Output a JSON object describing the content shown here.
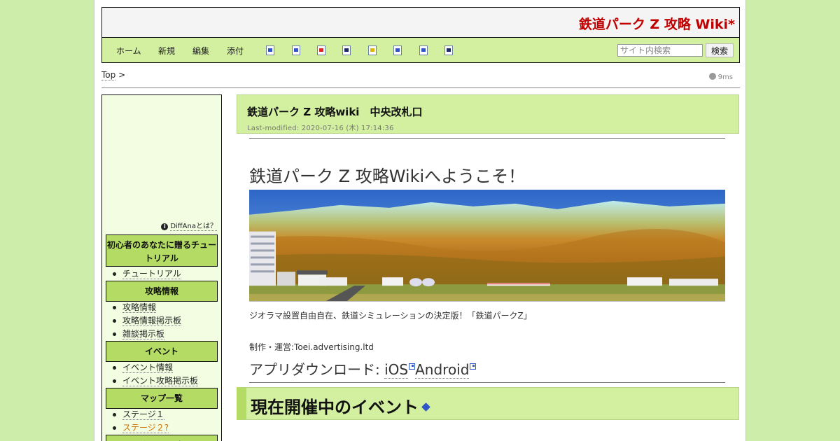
{
  "header": {
    "site_title": "鉄道パーク Z 攻略 Wiki*"
  },
  "nav": {
    "links": [
      "ホーム",
      "新規",
      "編集",
      "添付"
    ],
    "search_placeholder": "サイト内検索",
    "search_button": "検索"
  },
  "breadcrumb": {
    "top": "Top",
    "sep": ">"
  },
  "timer": "9ms",
  "sidebar": {
    "ad_link": "DiffAnaとは？",
    "sections": [
      {
        "title": "初心者のあなたに贈るチュートリアル",
        "items": [
          "チュートリアル"
        ]
      },
      {
        "title": "攻略情報",
        "items": [
          "攻略情報",
          "攻略情報掲示板",
          "雑談掲示板"
        ]
      },
      {
        "title": "イベント",
        "items": [
          "イベント情報",
          "イベント攻略掲示板"
        ]
      },
      {
        "title": "マップ一覧",
        "items": [
          "ステージ１",
          "ステージ２?"
        ]
      },
      {
        "title": "タワー一覧",
        "items": []
      }
    ]
  },
  "content": {
    "title": "鉄道パーク Z 攻略wiki　中央改札口",
    "last_modified": "Last-modified: 2020-07-16 (木) 17:14:36",
    "welcome": "鉄道パーク Z  攻略Wikiへようこそ！",
    "caption": "ジオラマ設置自由自在、鉄道シミュレーションの決定版！「鉄道パークZ」",
    "producer": "制作・運営:Toei.advertising.ltd",
    "download_label": "アプリダウンロード: ",
    "download_ios": "iOS",
    "download_android": "Android",
    "section_title": "現在開催中のイベント"
  },
  "colors": {
    "background": "#cdeeaa",
    "nav_bg": "#d2f0a0",
    "menu_head_bg": "#b4dc64",
    "title_red": "#c00000"
  }
}
